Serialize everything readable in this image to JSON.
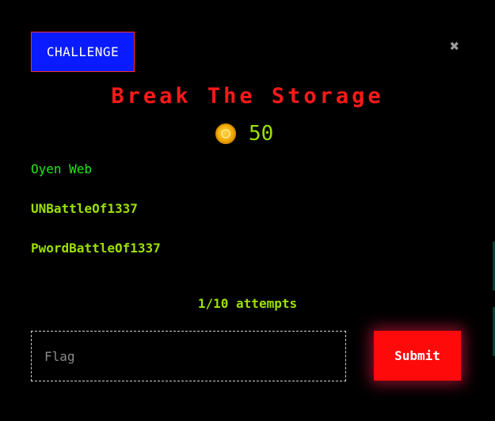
{
  "modal": {
    "badge_label": "CHALLENGE",
    "close_glyph": "✖",
    "title": "Break The Storage",
    "points": {
      "icon": "coin-icon",
      "value": "50"
    },
    "category": "Oyen Web",
    "hints": [
      "UNBattleOf1337",
      "PwordBattleOf1337"
    ],
    "attempts": "1/10 attempts",
    "flag_input": {
      "placeholder": "Flag",
      "value": ""
    },
    "submit_label": "Submit"
  },
  "colors": {
    "background": "#000000",
    "badge": "#0a1cff",
    "title": "#ff1a1a",
    "accent_green": "#9be000",
    "category_green": "#22e81a",
    "submit": "#ff0a0a"
  }
}
